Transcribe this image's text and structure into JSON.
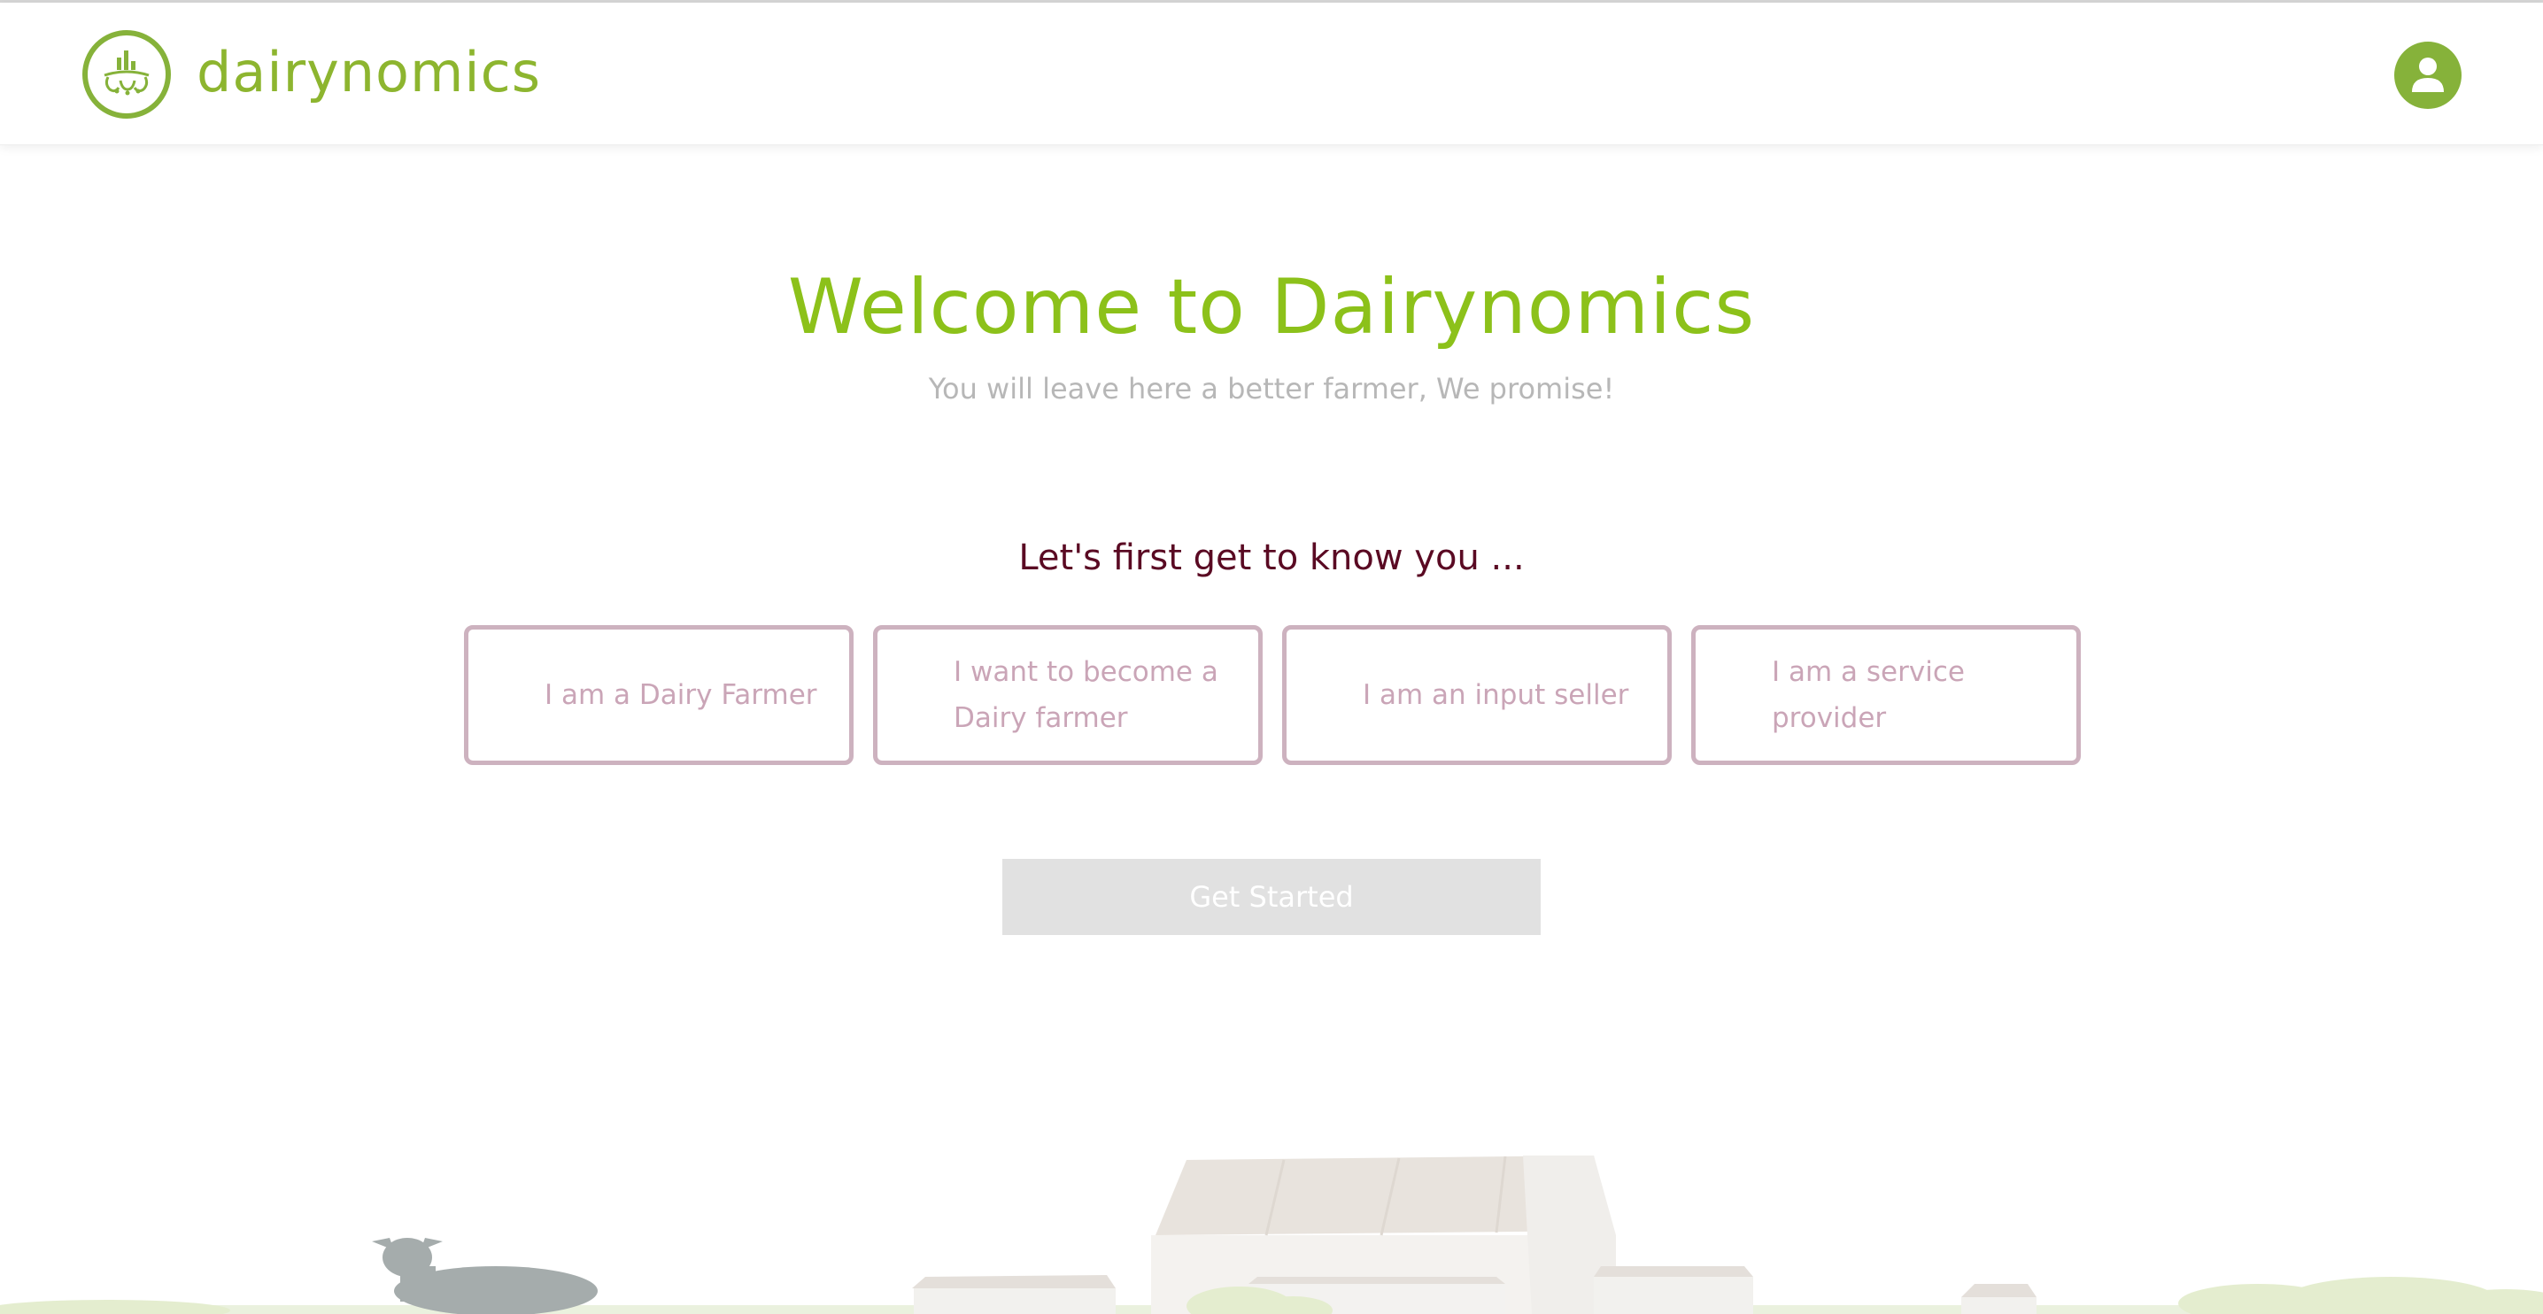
{
  "header": {
    "brand_name": "dairynomics",
    "logo_icon": "dairynomics-logo-icon",
    "profile_icon": "user-icon",
    "brand_color": "#8db52f"
  },
  "hero": {
    "title": "Welcome to Dairynomics",
    "subtitle": "You will leave here a better farmer, We promise!",
    "title_color": "#8cc11a"
  },
  "onboarding": {
    "heading": "Let's first get to know you ...",
    "options": [
      {
        "label": "I am a Dairy Farmer"
      },
      {
        "label": "I want to become a Dairy farmer"
      },
      {
        "label": "I am an input seller"
      },
      {
        "label": "I am a service provider"
      }
    ],
    "option_border_color": "#cdb2bf",
    "get_started_label": "Get Started",
    "get_started_disabled": true
  },
  "footer_illustration": {
    "icon": "farm-illustration",
    "elements": [
      "cow",
      "barn",
      "sheds",
      "bushes"
    ]
  }
}
